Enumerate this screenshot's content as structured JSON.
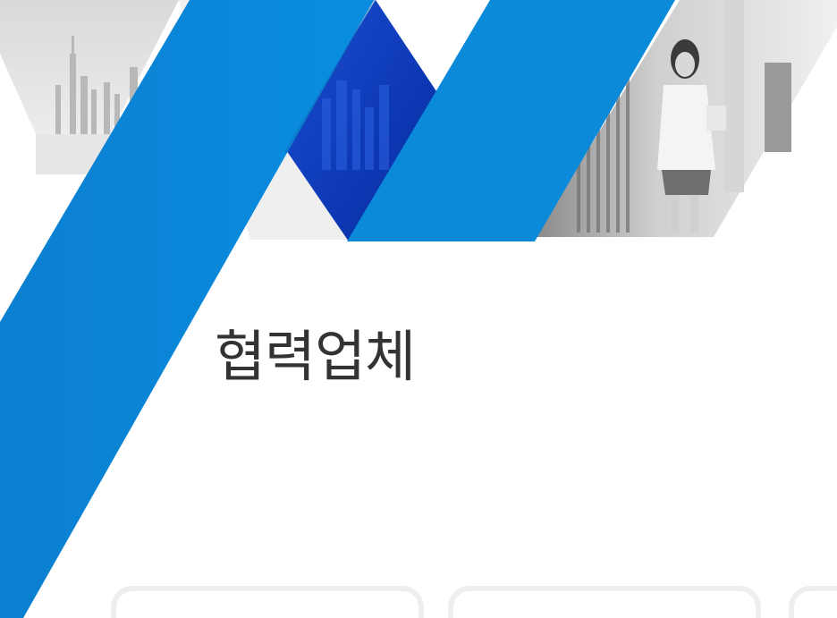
{
  "page": {
    "title": "협력업체",
    "colors": {
      "primary_blue": "#0a86d6",
      "deep_blue": "#0f3fc4",
      "title_text": "#333333",
      "photo_gray": "#c9c9c9",
      "card_border": "#eeeeee"
    }
  },
  "hero": {
    "images": [
      {
        "name": "city-skyline-photo"
      },
      {
        "name": "night-city-photo"
      },
      {
        "name": "walking-woman-photo"
      }
    ]
  },
  "partners": {
    "cards": [
      {
        "name": "partner-card-1"
      },
      {
        "name": "partner-card-2"
      },
      {
        "name": "partner-card-3"
      }
    ]
  }
}
